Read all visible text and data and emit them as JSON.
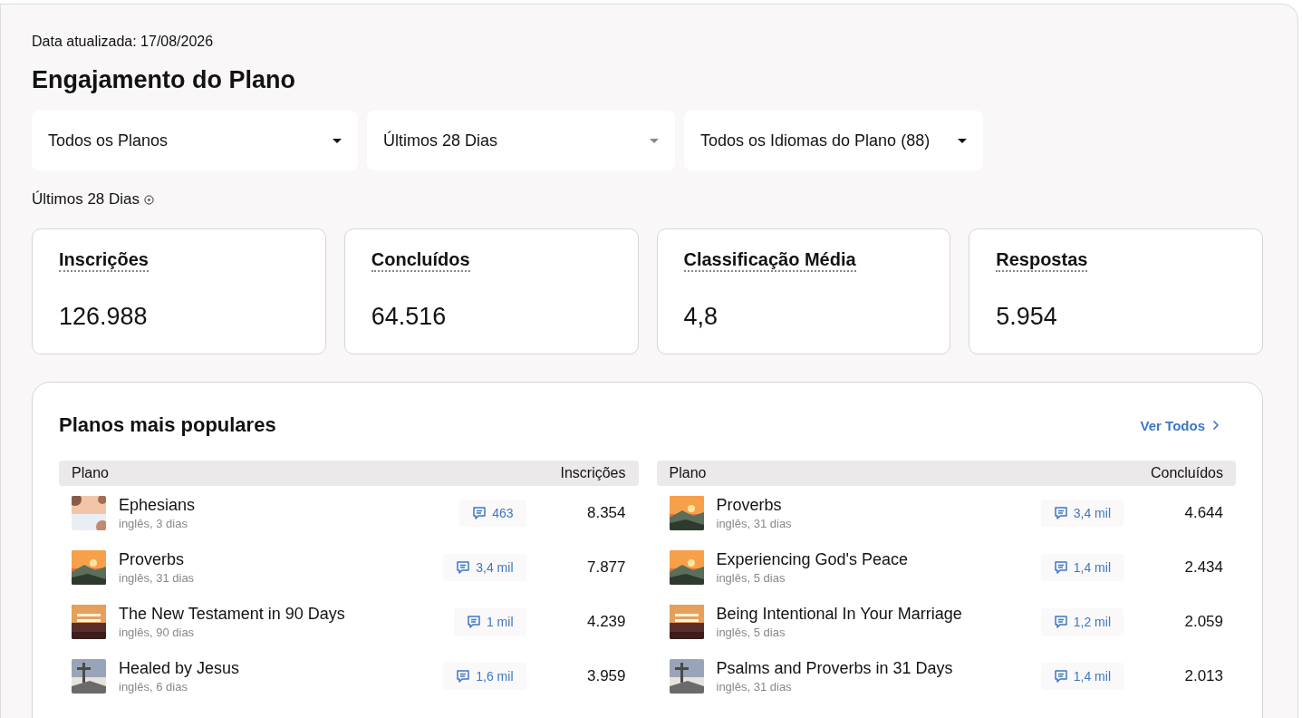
{
  "updated": "Data atualizada: 17/08/2026",
  "title": "Engajamento do Plano",
  "filters": [
    {
      "label": "Todos os Planos",
      "caret_muted": false
    },
    {
      "label": "Últimos 28 Dias",
      "caret_muted": true
    },
    {
      "label": "Todos os Idiomas do Plano (88)",
      "caret_muted": false
    }
  ],
  "period": "Últimos 28 Dias",
  "stats": [
    {
      "label": "Inscrições",
      "value": "126.988"
    },
    {
      "label": "Concluídos",
      "value": "64.516"
    },
    {
      "label": "Classificação Média",
      "value": "4,8"
    },
    {
      "label": "Respostas",
      "value": "5.954"
    }
  ],
  "popular": {
    "title": "Planos mais populares",
    "link": "Ver Todos",
    "tables": [
      {
        "columns": [
          "Plano",
          "Inscrições"
        ],
        "rows": [
          {
            "name": "Ephesians",
            "meta": "inglês, 3 dias",
            "comments": "463",
            "value": "8.354"
          },
          {
            "name": "Proverbs",
            "meta": "inglês, 31 dias",
            "comments": "3,4 mil",
            "value": "7.877"
          },
          {
            "name": "The New Testament in 90 Days",
            "meta": "inglês, 90 dias",
            "comments": "1 mil",
            "value": "4.239"
          },
          {
            "name": "Healed by Jesus",
            "meta": "inglês, 6 dias",
            "comments": "1,6 mil",
            "value": "3.959"
          }
        ]
      },
      {
        "columns": [
          "Plano",
          "Concluídos"
        ],
        "rows": [
          {
            "name": "Proverbs",
            "meta": "inglês, 31 dias",
            "comments": "3,4 mil",
            "value": "4.644"
          },
          {
            "name": "Experiencing God's Peace",
            "meta": "inglês, 5 dias",
            "comments": "1,4 mil",
            "value": "2.434"
          },
          {
            "name": "Being Intentional In Your Marriage",
            "meta": "inglês, 5 dias",
            "comments": "1,2 mil",
            "value": "2.059"
          },
          {
            "name": "Psalms and Proverbs in 31 Days",
            "meta": "inglês, 31 dias",
            "comments": "1,4 mil",
            "value": "2.013"
          }
        ]
      }
    ]
  }
}
